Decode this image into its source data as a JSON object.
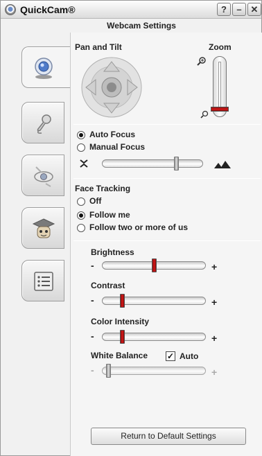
{
  "window": {
    "title": "QuickCam®",
    "subtitle": "Webcam Settings",
    "help_label": "?",
    "min_label": "–",
    "close_label": "✕"
  },
  "tabs": [
    {
      "name": "webcam-tab",
      "icon": "webcam-icon",
      "active": true
    },
    {
      "name": "audio-tab",
      "icon": "microphone-icon",
      "active": false
    },
    {
      "name": "effects-tab",
      "icon": "eye-icon",
      "active": false
    },
    {
      "name": "help-tab",
      "icon": "graduation-cap-icon",
      "active": false
    },
    {
      "name": "settings-list-tab",
      "icon": "list-icon",
      "active": false
    }
  ],
  "pan_tilt": {
    "label": "Pan and Tilt"
  },
  "zoom": {
    "label": "Zoom",
    "in_icon": "zoom-in-icon",
    "out_icon": "zoom-out-icon",
    "level": 0.05
  },
  "focus": {
    "auto_label": "Auto Focus",
    "manual_label": "Manual Focus",
    "selected": "auto",
    "near_icon": "near-focus-icon",
    "far_icon": "far-focus-icon",
    "slider_value": 0.75
  },
  "face_tracking": {
    "label": "Face Tracking",
    "options": [
      "Off",
      "Follow me",
      "Follow two or more of us"
    ],
    "selected": 1
  },
  "brightness": {
    "label": "Brightness",
    "minus": "-",
    "plus": "+",
    "value": 0.5
  },
  "contrast": {
    "label": "Contrast",
    "minus": "-",
    "plus": "+",
    "value": 0.17
  },
  "color_intensity": {
    "label": "Color Intensity",
    "minus": "-",
    "plus": "+",
    "value": 0.17
  },
  "white_balance": {
    "label": "White Balance",
    "auto_label": "Auto",
    "auto_checked": true,
    "check_mark": "✓",
    "minus": "-",
    "plus": "+",
    "value": 0.02
  },
  "buttons": {
    "default_label": "Return to Default Settings"
  },
  "colors": {
    "slider_thumb": "#c41414",
    "panel_bg": "#f5f5f5"
  }
}
